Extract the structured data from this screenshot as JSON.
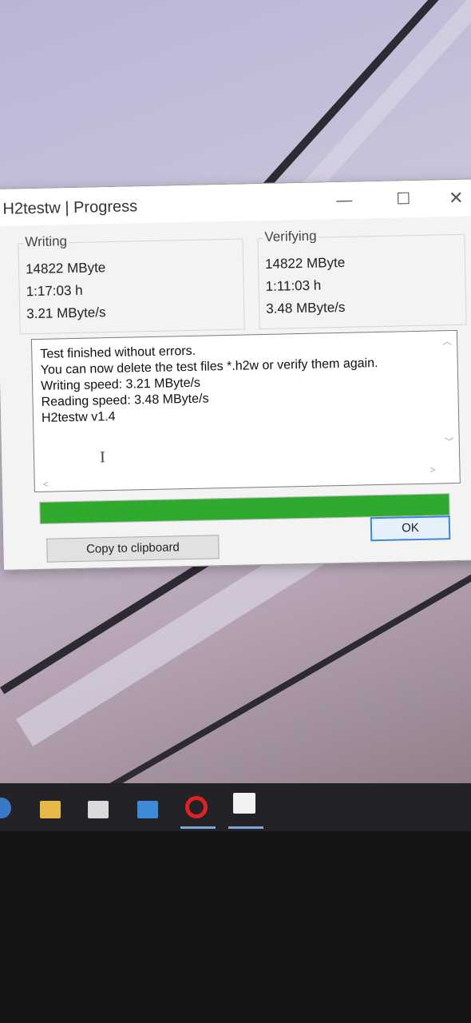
{
  "window": {
    "title": "H2testw | Progress",
    "minimize_glyph": "—",
    "maximize_glyph": "☐",
    "close_glyph": "✕"
  },
  "writing": {
    "label": "Writing",
    "size": "14822 MByte",
    "time": "1:17:03 h",
    "speed": "3.21 MByte/s"
  },
  "verifying": {
    "label": "Verifying",
    "size": "14822 MByte",
    "time": "1:11:03 h",
    "speed": "3.48 MByte/s"
  },
  "log": {
    "lines": [
      "Test finished without errors.",
      "You can now delete the test files *.h2w or verify them again.",
      "Writing speed: 3.21 MByte/s",
      "Reading speed: 3.48 MByte/s",
      "H2testw v1.4"
    ]
  },
  "progress": {
    "percent": 100,
    "color": "#2faa2f"
  },
  "buttons": {
    "ok": "OK",
    "copy": "Copy to clipboard"
  },
  "taskbar": {
    "icons": [
      "edge-icon",
      "file-explorer-icon",
      "store-icon",
      "mail-icon",
      "opera-icon",
      "h2testw-icon"
    ]
  }
}
